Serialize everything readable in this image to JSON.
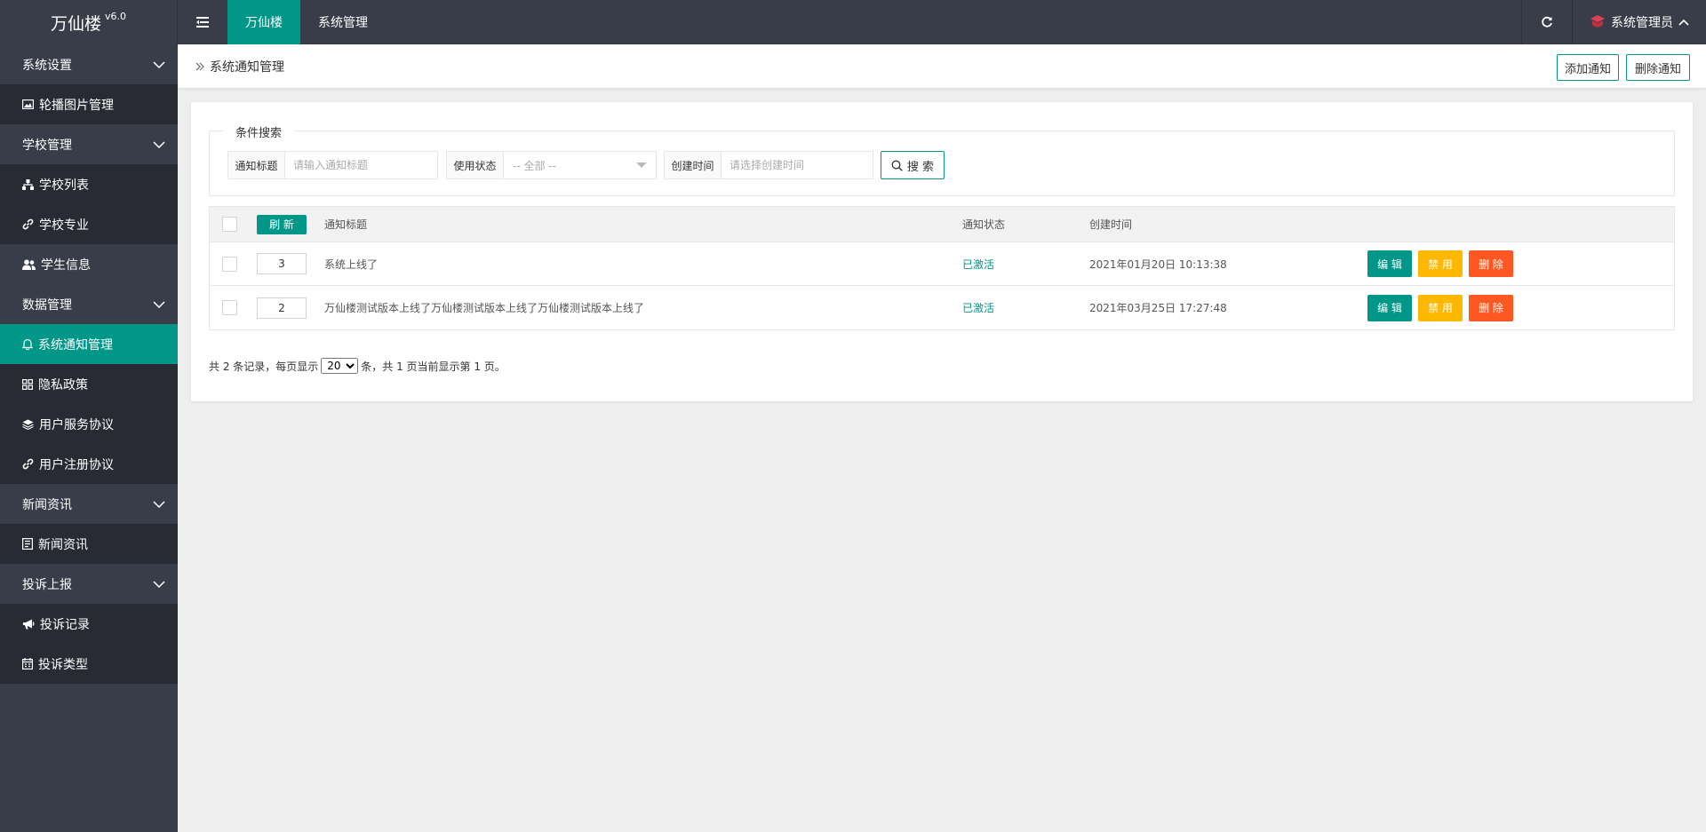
{
  "app": {
    "name": "万仙楼",
    "version": "v6.0"
  },
  "topbar": {
    "tabs": [
      {
        "label": "万仙楼",
        "active": true
      },
      {
        "label": "系统管理",
        "active": false
      }
    ],
    "user_label": "系统管理员"
  },
  "sidebar": {
    "groups": [
      {
        "label": "系统设置",
        "items": [
          {
            "label": "轮播图片管理",
            "icon": "image-icon"
          }
        ]
      },
      {
        "label": "学校管理",
        "items": [
          {
            "label": "学校列表",
            "icon": "sitemap-icon"
          },
          {
            "label": "学校专业",
            "icon": "link-icon"
          },
          {
            "label": "学生信息",
            "icon": "users-icon"
          }
        ]
      },
      {
        "label": "数据管理",
        "items": [
          {
            "label": "系统通知管理",
            "icon": "bell-icon",
            "active": true
          },
          {
            "label": "隐私政策",
            "icon": "grid-icon"
          },
          {
            "label": "用户服务协议",
            "icon": "layers-icon"
          },
          {
            "label": "用户注册协议",
            "icon": "link-icon"
          }
        ]
      },
      {
        "label": "新闻资讯",
        "items": [
          {
            "label": "新闻资讯",
            "icon": "news-icon"
          }
        ]
      },
      {
        "label": "投诉上报",
        "items": [
          {
            "label": "投诉记录",
            "icon": "bullhorn-icon"
          },
          {
            "label": "投诉类型",
            "icon": "calendar-icon"
          }
        ]
      }
    ]
  },
  "breadcrumb": {
    "current": "系统通知管理"
  },
  "toolbar": {
    "add_label": "添加通知",
    "delete_label": "删除通知"
  },
  "search": {
    "legend": "条件搜索",
    "title_label": "通知标题",
    "title_placeholder": "请输入通知标题",
    "status_label": "使用状态",
    "status_value": "-- 全部 --",
    "date_label": "创建时间",
    "date_placeholder": "请选择创建时间",
    "button_label": "搜 索"
  },
  "table": {
    "refresh_label": "刷 新",
    "headers": {
      "title": "通知标题",
      "status": "通知状态",
      "created": "创建时间"
    },
    "rows": [
      {
        "sort": "3",
        "title": "系统上线了",
        "status": "已激活",
        "created": "2021年01月20日 10:13:38"
      },
      {
        "sort": "2",
        "title": "万仙楼测试版本上线了万仙楼测试版本上线了万仙楼测试版本上线了",
        "status": "已激活",
        "created": "2021年03月25日 17:27:48"
      }
    ],
    "actions": {
      "edit": "编 辑",
      "disable": "禁 用",
      "delete": "删 除"
    }
  },
  "pager": {
    "prefix": "共 2 条记录，每页显示",
    "page_size": "20",
    "suffix": "条，共 1 页当前显示第 1 页。"
  },
  "colors": {
    "accent": "#009688",
    "warning": "#ffb800",
    "danger": "#ff5722",
    "sidebar": "#393d49",
    "sidebar_item": "#282b33"
  }
}
